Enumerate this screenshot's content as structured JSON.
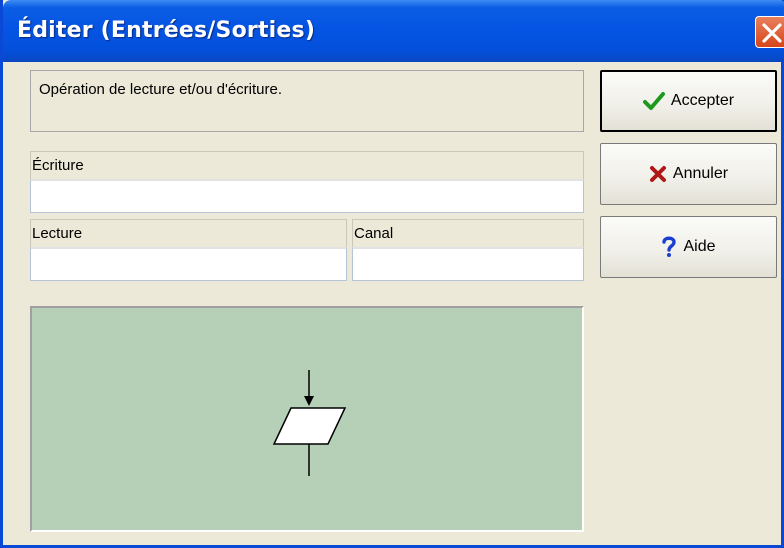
{
  "window": {
    "title": "Éditer (Entrées/Sorties)",
    "colors": {
      "titlebar": "#0554e3",
      "dialog": "#ece9d8",
      "diagram_bg": "#b5d0b6",
      "close": "#d6451c"
    }
  },
  "description": "Opération de lecture et/ou d'écriture.",
  "fields": {
    "ecriture": {
      "label": "Écriture",
      "value": ""
    },
    "lecture": {
      "label": "Lecture",
      "value": ""
    },
    "canal": {
      "label": "Canal",
      "value": ""
    }
  },
  "buttons": {
    "accepter": {
      "label": "Accepter",
      "icon": "checkmark-icon",
      "color": "#1c9a1c"
    },
    "annuler": {
      "label": "Annuler",
      "icon": "x-mark-icon",
      "color": "#b01818"
    },
    "aide": {
      "label": "Aide",
      "icon": "question-mark-icon",
      "color": "#1a3fd0"
    }
  },
  "diagram": {
    "shape": "parallelogram-io-symbol"
  }
}
